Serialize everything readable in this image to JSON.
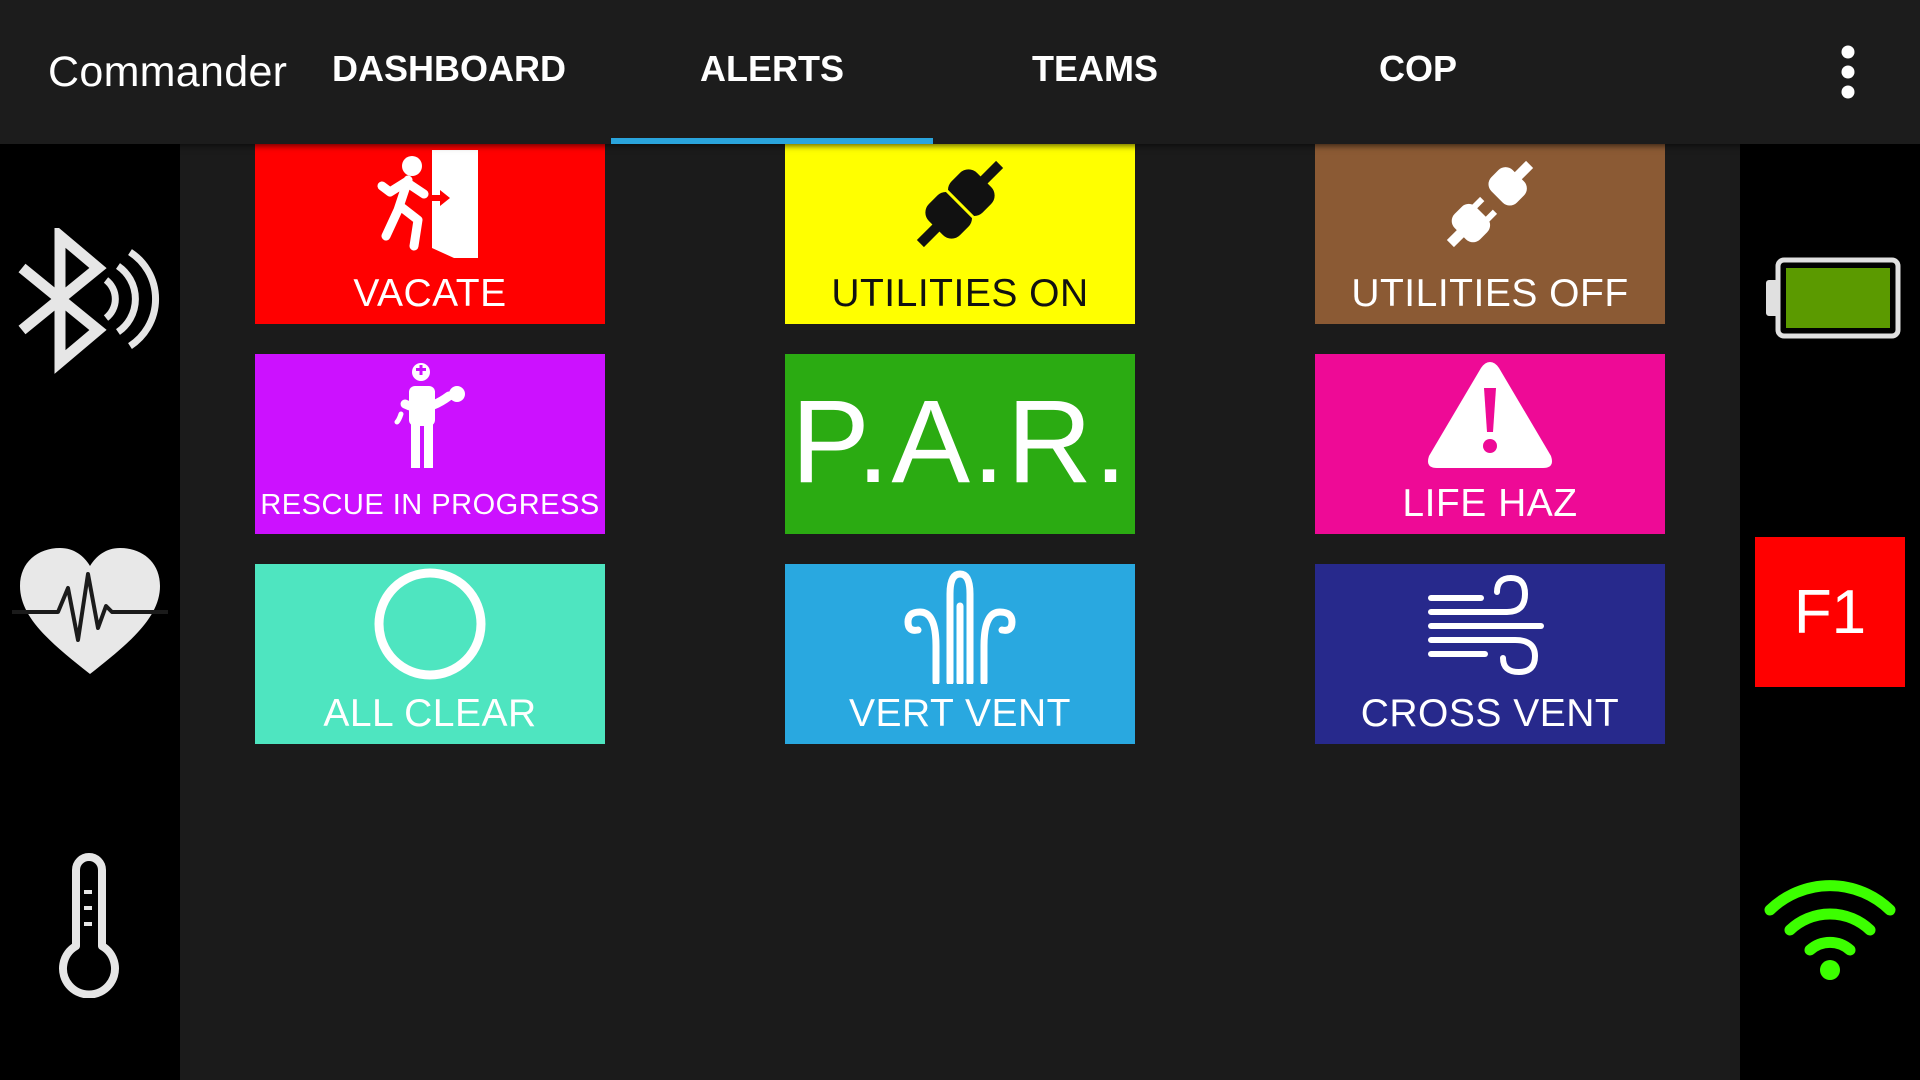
{
  "app": {
    "title": "Commander"
  },
  "tabs": [
    {
      "label": "DASHBOARD",
      "selected": false
    },
    {
      "label": "ALERTS",
      "selected": true
    },
    {
      "label": "TEAMS",
      "selected": false
    },
    {
      "label": "COP",
      "selected": false
    }
  ],
  "menu": {
    "icon": "more-vert-icon"
  },
  "left_status": {
    "icons": [
      "bluetooth-icon",
      "heart-rate-icon",
      "thermometer-icon"
    ]
  },
  "right_status": {
    "battery_icon": "battery-icon",
    "battery_color": "#5b9a00",
    "floor_badge": "F1",
    "floor_badge_color": "#ff0000",
    "wifi_icon": "wifi-icon",
    "wifi_color": "#3cff00"
  },
  "alerts": [
    {
      "label": "VACATE",
      "color": "#ff0000",
      "icon": "exit-icon"
    },
    {
      "label": "UTILITIES ON",
      "color": "#ffff00",
      "icon": "plug-connected-icon"
    },
    {
      "label": "UTILITIES OFF",
      "color": "#8b5a34",
      "icon": "plug-disconnected-icon"
    },
    {
      "label": "RESCUE IN PROGRESS",
      "color": "#cc11ff",
      "icon": "rescue-icon"
    },
    {
      "label": "P.A.R.",
      "color": "#2bab12"
    },
    {
      "label": "LIFE HAZ",
      "color": "#ee0a96",
      "icon": "warning-icon"
    },
    {
      "label": "ALL CLEAR",
      "color": "#4ee5c0",
      "icon": "circle-icon"
    },
    {
      "label": "VERT VENT",
      "color": "#29a8e0",
      "icon": "vertical-vent-icon"
    },
    {
      "label": "CROSS VENT",
      "color": "#27298c",
      "icon": "wind-icon"
    }
  ]
}
